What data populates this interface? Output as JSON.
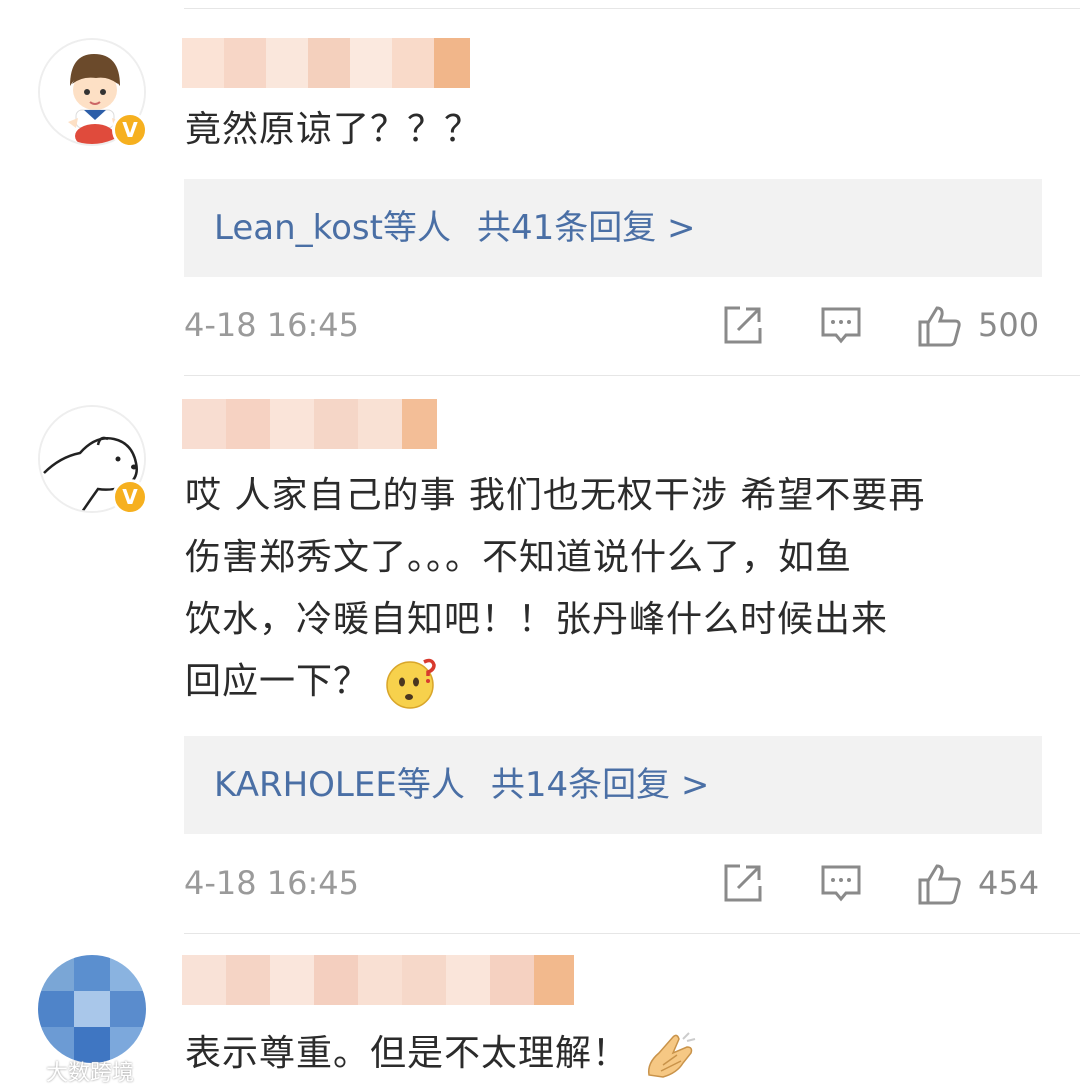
{
  "comments": [
    {
      "text": "竟然原谅了？？？",
      "reply": {
        "users": "Lean_kost等人",
        "count_label": "共41条回复 >"
      },
      "time": "4-18 16:45",
      "likes": "500",
      "avatar": "cartoon-boy-avatar",
      "verified": true
    },
    {
      "text_lines": [
        "哎 人家自己的事 我们也无权干涉 希望不要再",
        "伤害郑秀文了。。。不知道说什么了，如鱼",
        "饮水，冷暖自知吧！！张丹峰什么时候出来",
        "回应一下？"
      ],
      "emoji": "thinking-face-emoji",
      "reply": {
        "users": "KARHOLEE等人",
        "count_label": "共14条回复 >"
      },
      "time": "4-18 16:45",
      "likes": "454",
      "avatar": "polar-bear-avatar",
      "verified": true
    },
    {
      "text": "表示尊重。但是不太理解！",
      "emoji": "praying-hands-emoji",
      "avatar": "blurred-avatar"
    }
  ],
  "watermark": {
    "text": "大数跨境"
  },
  "colors": {
    "link": "#4a6fa5",
    "badge": "#f6b01f",
    "reply_bg": "#f2f2f2",
    "meta": "#9a9a9a"
  }
}
